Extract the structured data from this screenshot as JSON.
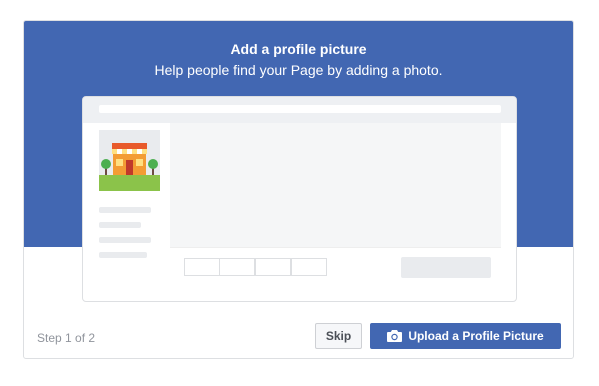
{
  "dialog": {
    "title": "Add a profile picture",
    "subtitle": "Help people find your Page by adding a photo."
  },
  "footer": {
    "step_text": "Step 1 of 2",
    "skip_label": "Skip",
    "upload_label": "Upload a Profile Picture",
    "upload_icon": "camera-icon"
  },
  "illustration": {
    "avatar_icon": "storefront-icon"
  },
  "colors": {
    "brand_blue": "#4267b2",
    "border": "#dddfe2",
    "muted_text": "#90949c",
    "button_text": "#4b4f56"
  }
}
